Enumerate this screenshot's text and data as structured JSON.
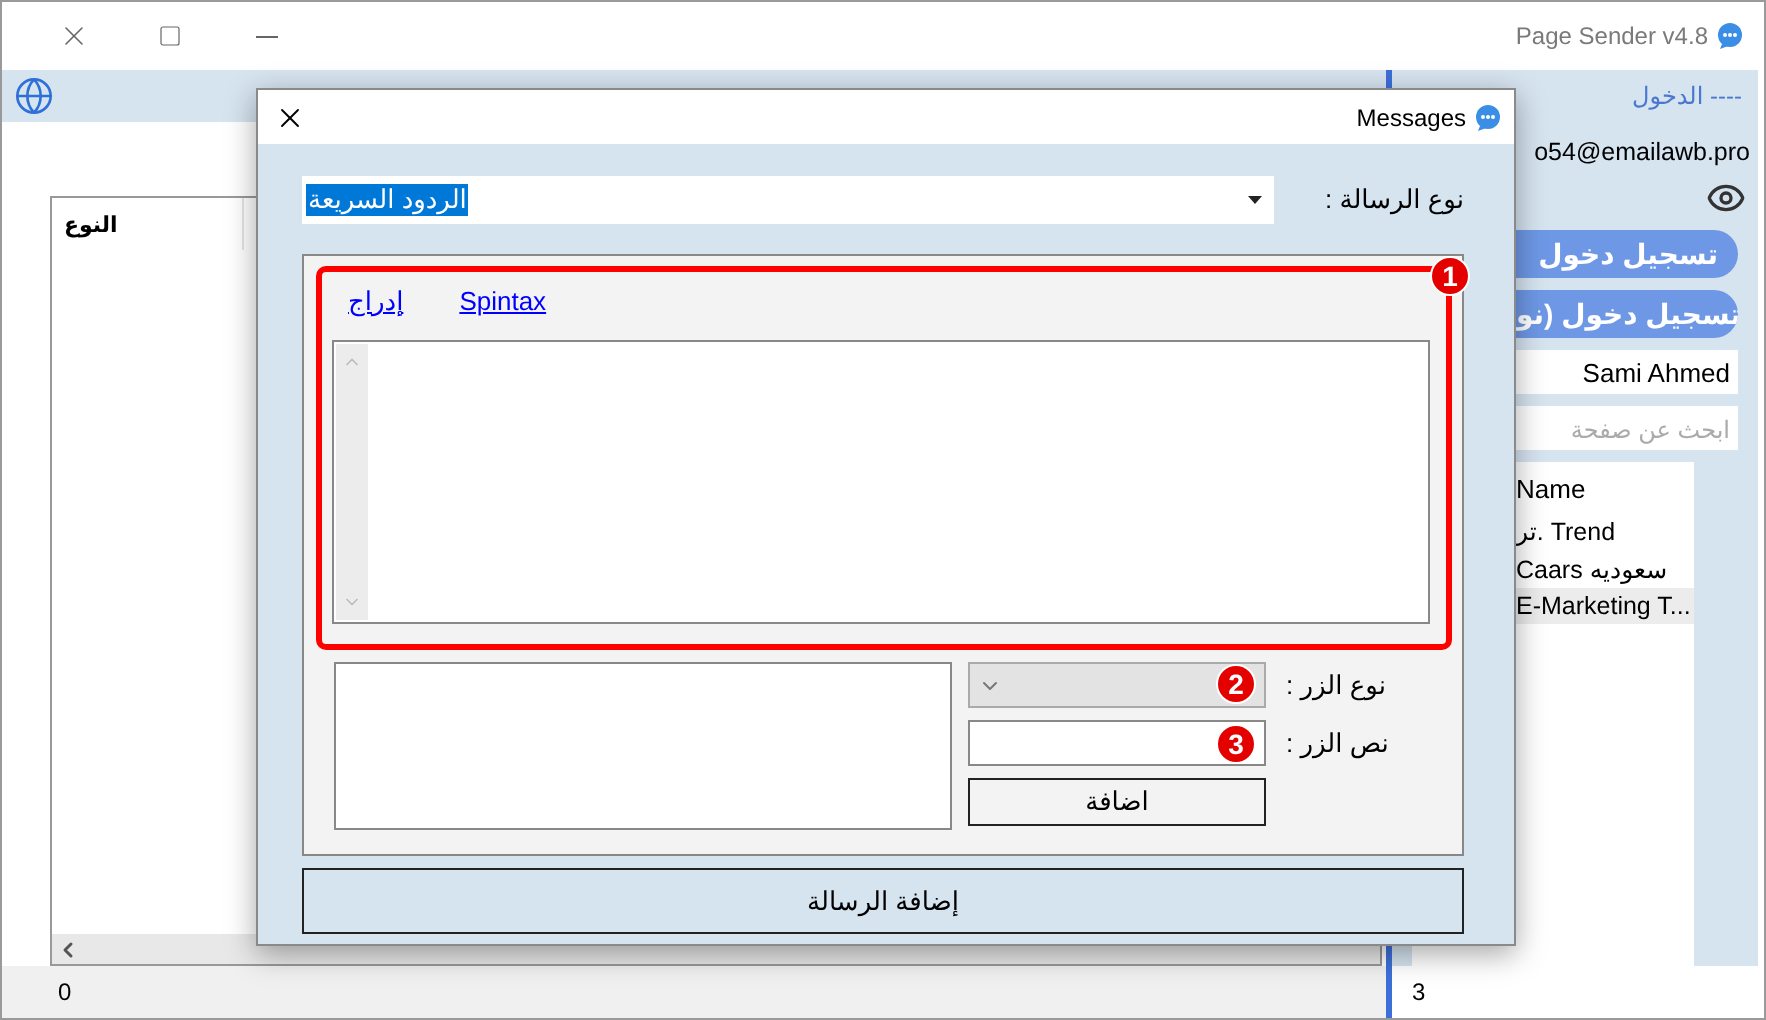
{
  "window": {
    "title": "Page Sender v4.8"
  },
  "main": {
    "table": {
      "columns": [
        "النوع"
      ]
    },
    "status": "0"
  },
  "sidebar": {
    "login_link": "الدخول ----",
    "email": "o54@emailawb.pro",
    "buttons": [
      "تسجيل دخول",
      "تسجيل دخول (نو"
    ],
    "name_field": {
      "value": "Sami Ahmed"
    },
    "search": {
      "placeholder": "ابحث عن صفحة"
    },
    "pages": {
      "columns": [
        "Name"
      ],
      "rows": [
        {
          "name": "تر. Trend",
          "selected": false
        },
        {
          "name": "Caars سعوديه",
          "selected": false
        },
        {
          "name": "E-Marketing T...",
          "selected": true
        }
      ]
    },
    "status": "3"
  },
  "dialog": {
    "title": "Messages",
    "message_type": {
      "label": "نوع الرسالة :",
      "value": "الردود السريعة",
      "text_selected": true
    },
    "editor": {
      "links": [
        "Spintax",
        "إدراج"
      ],
      "badge": "1"
    },
    "button_type": {
      "label": "نوع الزر :",
      "badge": "2",
      "disabled": true
    },
    "button_text": {
      "label": "نص الزر :",
      "badge": "3"
    },
    "add_button": "اضافة",
    "submit_button": "إضافة الرسالة"
  }
}
